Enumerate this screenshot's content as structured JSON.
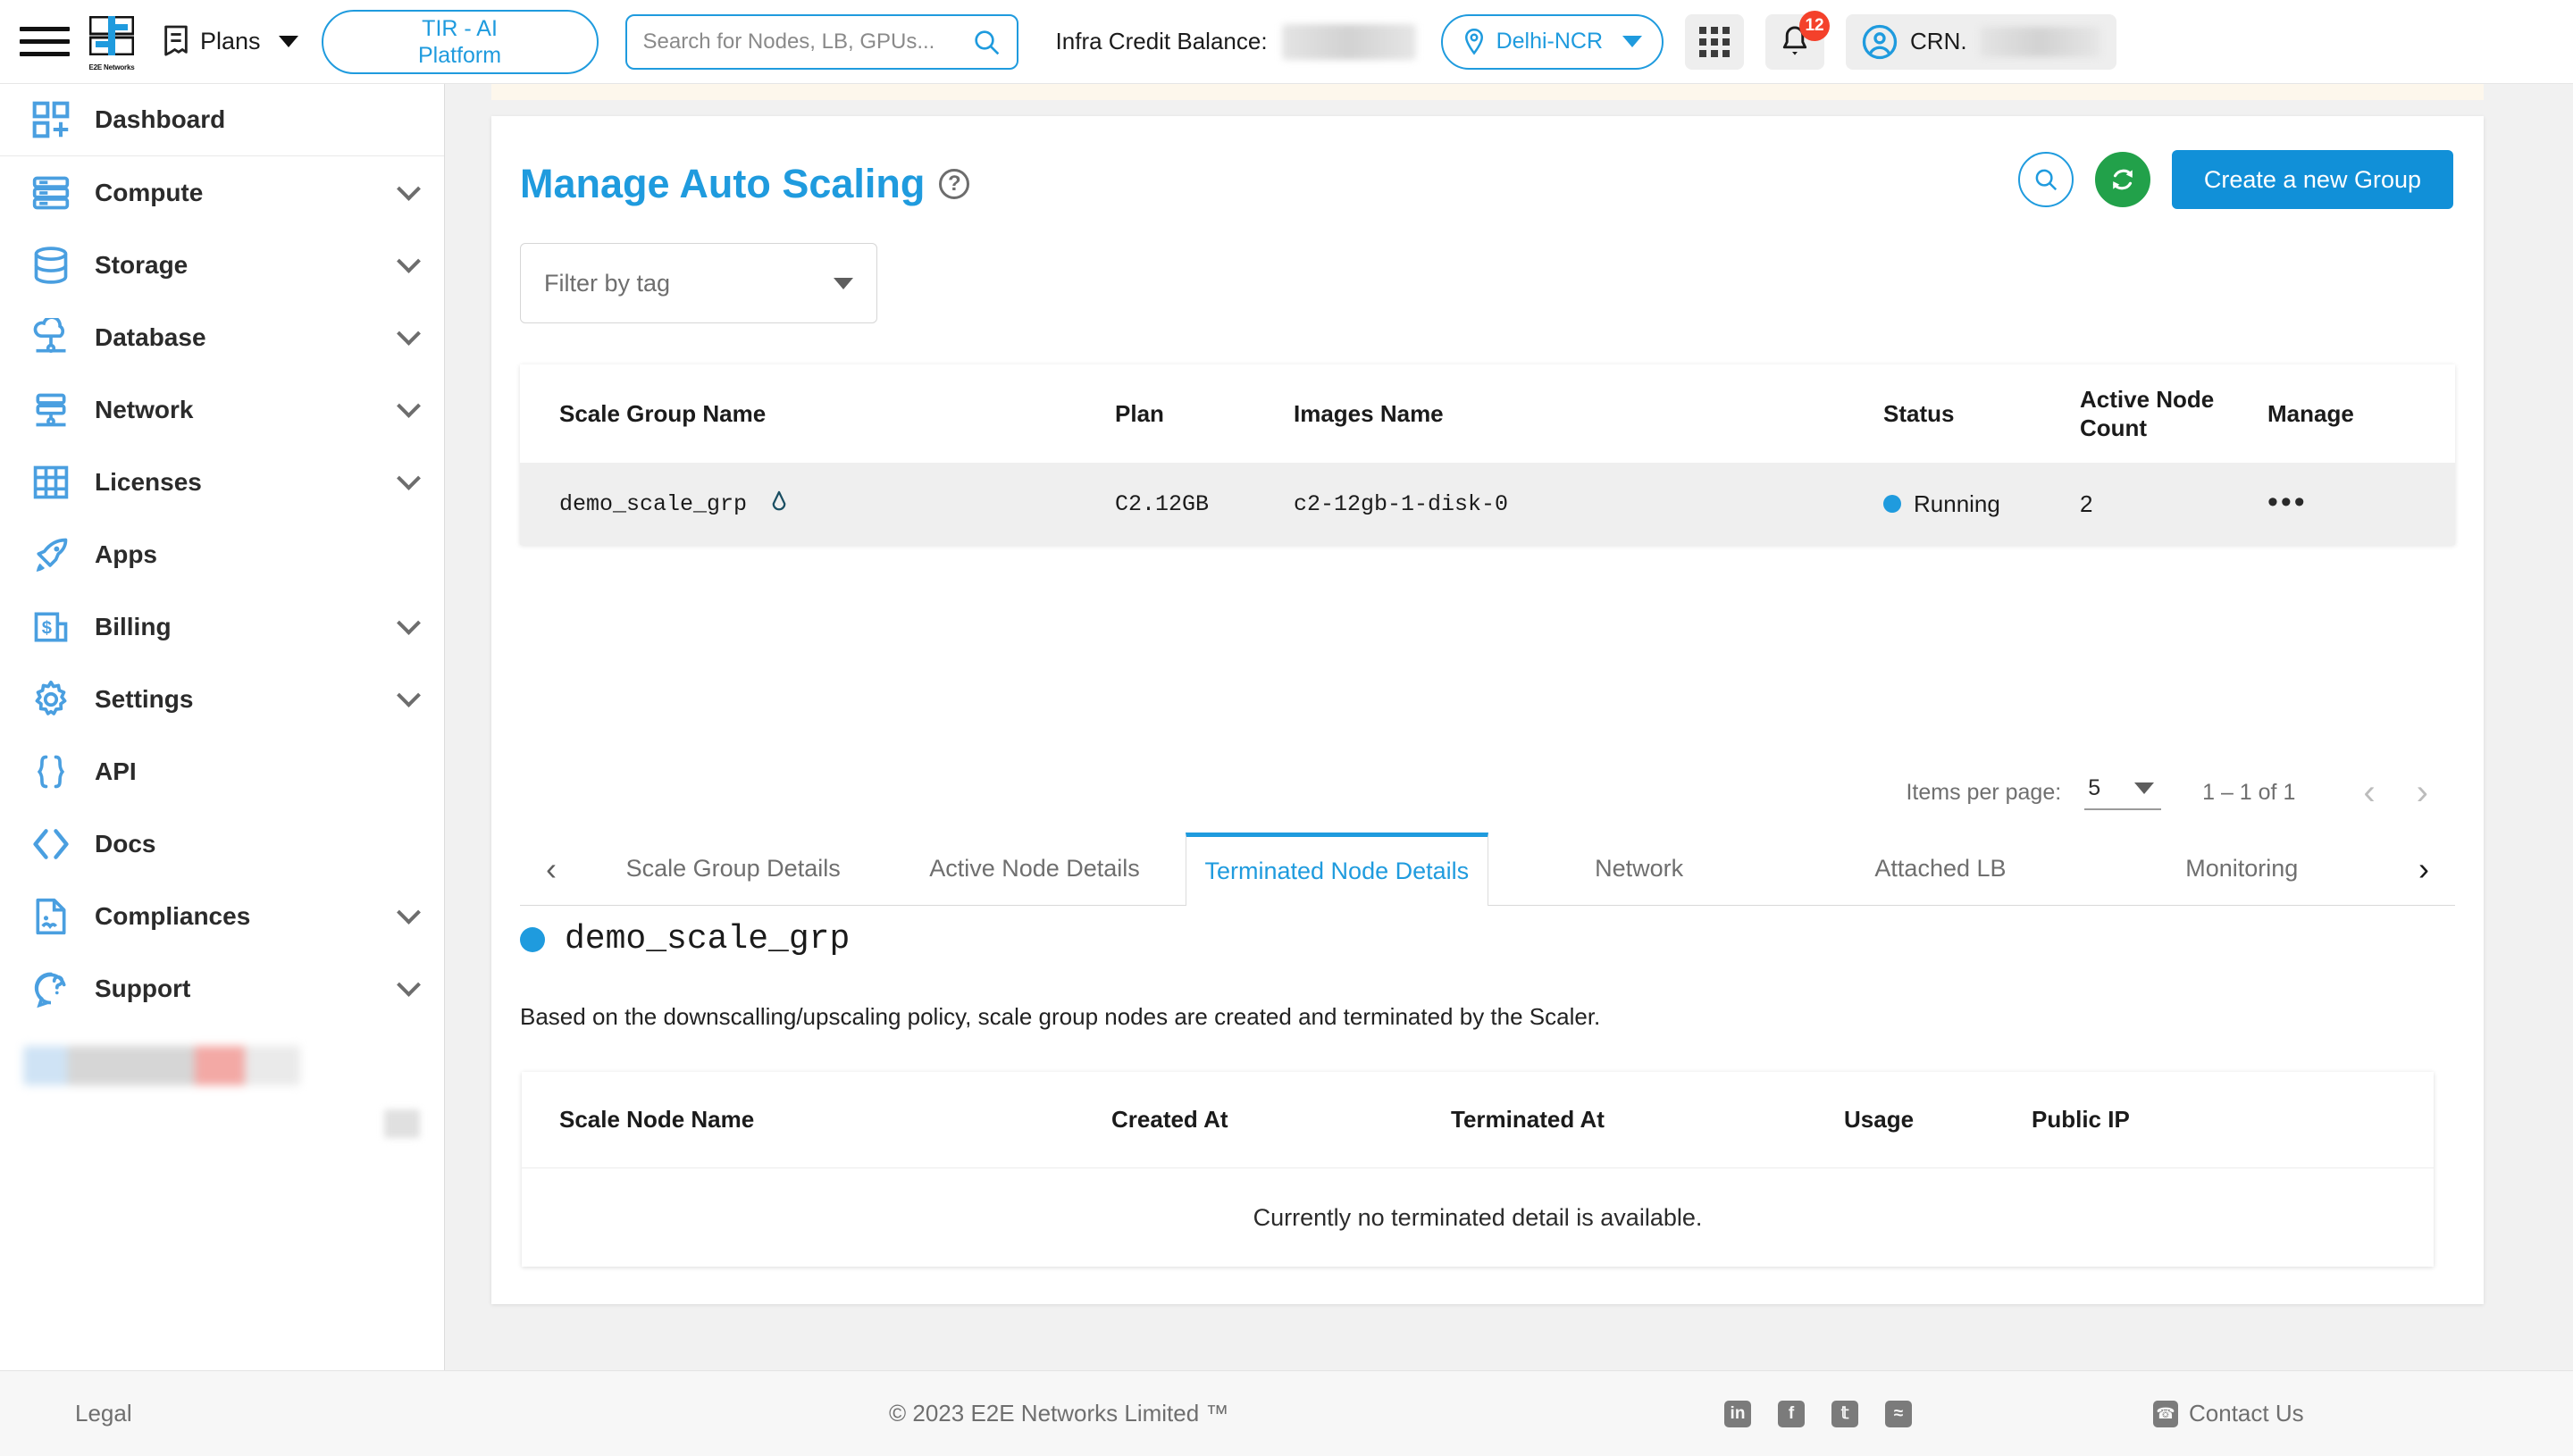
{
  "header": {
    "menu_icon": "hamburger-icon",
    "logo_caption": "E2E Networks",
    "plans_label": "Plans",
    "tir_button": "TIR - AI\nPlatform",
    "tir_line1": "TIR - AI",
    "tir_line2": "Platform",
    "search_placeholder": "Search for Nodes, LB, GPUs...",
    "search_value": "",
    "credit_label": "Infra Credit Balance:",
    "credit_value_masked": "",
    "region": "Delhi-NCR",
    "notification_count": "12",
    "user_label": "CRN."
  },
  "sidebar": {
    "items": [
      {
        "label": "Dashboard",
        "icon": "dashboard-icon",
        "expandable": false
      },
      {
        "label": "Compute",
        "icon": "server-icon",
        "expandable": true
      },
      {
        "label": "Storage",
        "icon": "database-icon",
        "expandable": true
      },
      {
        "label": "Database",
        "icon": "cloud-db-icon",
        "expandable": true
      },
      {
        "label": "Network",
        "icon": "network-icon",
        "expandable": true
      },
      {
        "label": "Licenses",
        "icon": "license-icon",
        "expandable": true
      },
      {
        "label": "Apps",
        "icon": "rocket-icon",
        "expandable": false
      },
      {
        "label": "Billing",
        "icon": "billing-icon",
        "expandable": true
      },
      {
        "label": "Settings",
        "icon": "gear-icon",
        "expandable": true
      },
      {
        "label": "API",
        "icon": "braces-icon",
        "expandable": false
      },
      {
        "label": "Docs",
        "icon": "code-icon",
        "expandable": false
      },
      {
        "label": "Compliances",
        "icon": "document-icon",
        "expandable": true
      },
      {
        "label": "Support",
        "icon": "support-chat-icon",
        "expandable": true
      }
    ]
  },
  "page": {
    "title": "Manage Auto Scaling",
    "help_icon": "question-mark-icon",
    "search_icon": "search-icon",
    "refresh_icon": "refresh-icon",
    "create_button": "Create a new Group",
    "filter_placeholder": "Filter by tag"
  },
  "scale_groups_table": {
    "columns": [
      "Scale Group Name",
      "Plan",
      "Images Name",
      "Status",
      "Active Node Count",
      "Manage"
    ],
    "rows": [
      {
        "name": "demo_scale_grp",
        "plan": "C2.12GB",
        "image": "c2-12gb-1-disk-0",
        "status": "Running",
        "status_color": "#1f9bde",
        "active_node_count": "2",
        "manage": "•••"
      }
    ]
  },
  "paginator": {
    "items_per_page_label": "Items per page:",
    "items_per_page_value": "5",
    "range_label": "1 – 1 of 1",
    "prev_icon": "chevron-left-icon",
    "next_icon": "chevron-right-icon"
  },
  "tabs": {
    "prev_icon": "chevron-left-icon",
    "next_icon": "chevron-right-icon",
    "items": [
      {
        "label": "Scale Group Details",
        "active": false
      },
      {
        "label": "Active Node Details",
        "active": false
      },
      {
        "label": "Terminated Node Details",
        "active": true
      },
      {
        "label": "Network",
        "active": false
      },
      {
        "label": "Attached LB",
        "active": false
      },
      {
        "label": "Monitoring",
        "active": false
      }
    ]
  },
  "tab_panel": {
    "group_name": "demo_scale_grp",
    "group_status_color": "#1f9bde",
    "description": "Based on the downscalling/upscaling policy, scale group nodes are created and terminated by the Scaler.",
    "table": {
      "columns": [
        "Scale Node Name",
        "Created At",
        "Terminated At",
        "Usage",
        "Public IP"
      ],
      "empty_message": "Currently no terminated detail is available."
    }
  },
  "footer": {
    "legal": "Legal",
    "copyright": "© 2023 E2E Networks Limited ™",
    "social": [
      {
        "name": "linkedin-icon",
        "glyph": "in"
      },
      {
        "name": "facebook-icon",
        "glyph": "f"
      },
      {
        "name": "twitter-icon",
        "glyph": "𝕥"
      },
      {
        "name": "rss-icon",
        "glyph": "≈"
      }
    ],
    "contact": "Contact Us"
  },
  "colors": {
    "accent": "#1f9bde",
    "primary_button": "#1190d8",
    "refresh_green": "#22a14a",
    "badge_red": "#f4412b"
  }
}
